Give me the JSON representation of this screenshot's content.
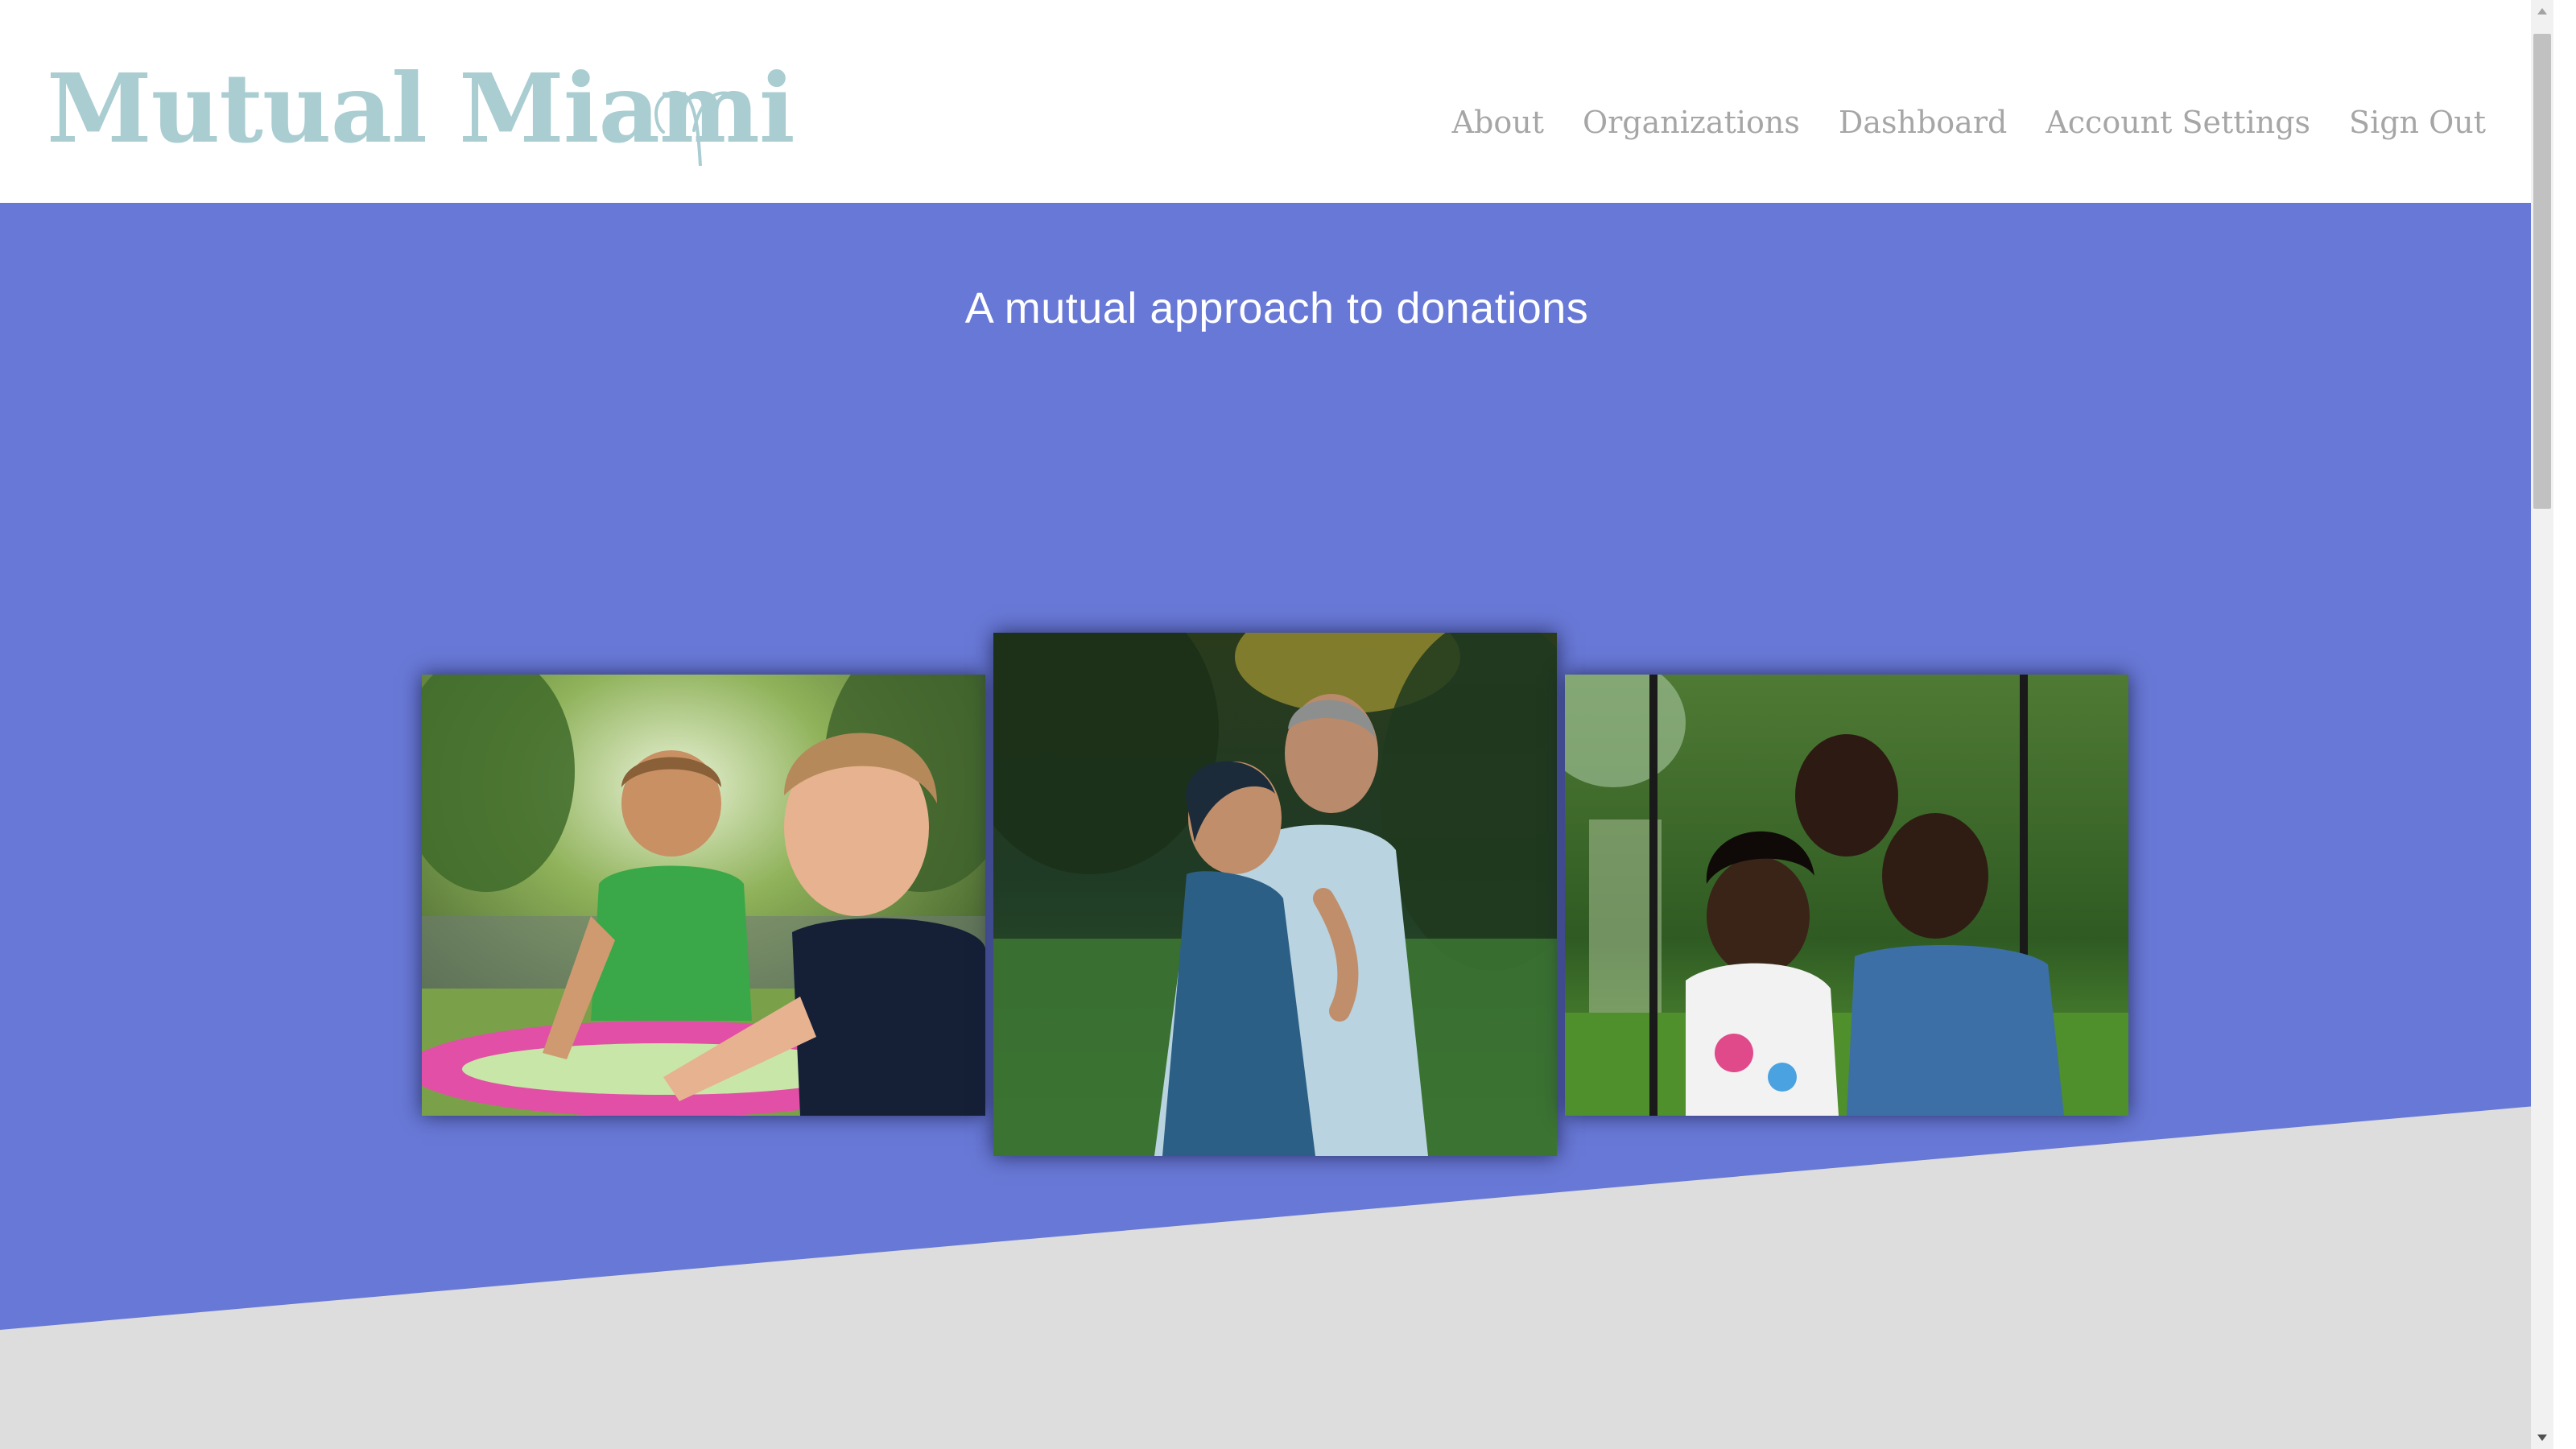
{
  "header": {
    "logo_text": "Mutual Miami",
    "nav": {
      "about": "About",
      "organizations": "Organizations",
      "dashboard": "Dashboard",
      "account_settings": "Account Settings",
      "sign_out": "Sign Out"
    }
  },
  "hero": {
    "tagline": "A mutual approach to donations",
    "photos": [
      {
        "subject": "two children playing by a pink paddling pool"
      },
      {
        "subject": "man embracing a woman outdoors"
      },
      {
        "subject": "three children on a rope swing"
      }
    ]
  },
  "colors": {
    "logo": "#a9cdd1",
    "nav_text": "#a6a6a6",
    "hero_bg": "#6878d6",
    "lower_bg": "#dddddd"
  }
}
